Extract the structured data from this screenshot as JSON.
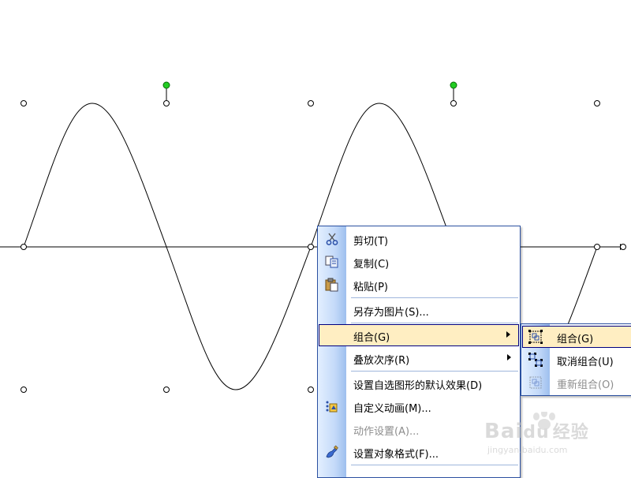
{
  "context_menu": {
    "items": [
      {
        "label": "剪切(T)",
        "icon": "scissors-icon",
        "enabled": true
      },
      {
        "label": "复制(C)",
        "icon": "copy-icon",
        "enabled": true
      },
      {
        "label": "粘贴(P)",
        "icon": "paste-icon",
        "enabled": true
      },
      {
        "label": "另存为图片(S)...",
        "icon": "",
        "enabled": true
      },
      {
        "label": "组合(G)",
        "icon": "",
        "enabled": true,
        "submenu": true,
        "highlighted": true
      },
      {
        "label": "叠放次序(R)",
        "icon": "",
        "enabled": true,
        "submenu": true
      },
      {
        "label": "设置自选图形的默认效果(D)",
        "icon": "",
        "enabled": true
      },
      {
        "label": "自定义动画(M)...",
        "icon": "custom-animation-icon",
        "enabled": true
      },
      {
        "label": "动作设置(A)...",
        "icon": "",
        "enabled": false
      },
      {
        "label": "设置对象格式(F)...",
        "icon": "format-object-icon",
        "enabled": true
      }
    ]
  },
  "submenu": {
    "items": [
      {
        "label": "组合(G)",
        "icon": "group-icon",
        "enabled": true,
        "highlighted": true
      },
      {
        "label": "取消组合(U)",
        "icon": "ungroup-icon",
        "enabled": true
      },
      {
        "label": "重新组合(O)",
        "icon": "regroup-icon",
        "enabled": false
      }
    ]
  },
  "watermark": {
    "brand": "Bai",
    "brand_tail": "du",
    "product": "经验",
    "url": "jingyan.baidu.com"
  },
  "colors": {
    "menu_border": "#2b50a0",
    "highlight_fill": "#ffeec2",
    "highlight_border": "#000080",
    "rotation_handle": "#22cc22",
    "disabled_text": "#8d8d8d"
  }
}
